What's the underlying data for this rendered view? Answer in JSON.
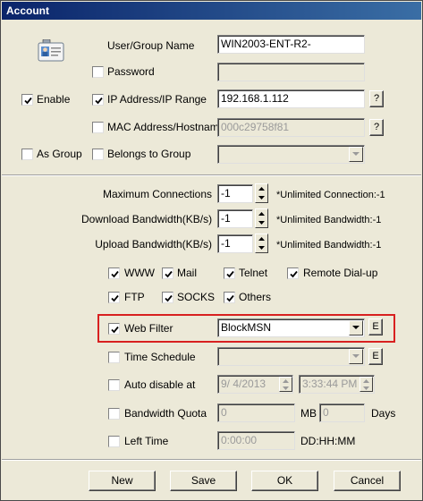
{
  "window": {
    "title": "Account"
  },
  "account": {
    "user_group_name_label": "User/Group Name",
    "user_group_name_value": "WIN2003-ENT-R2-",
    "password_label": "Password",
    "password_checked": false,
    "password_value": "",
    "enable_label": "Enable",
    "enable_checked": true,
    "ip_label": "IP Address/IP Range",
    "ip_checked": true,
    "ip_value": "192.168.1.112",
    "ip_help": "?",
    "mac_label": "MAC Address/Hostname",
    "mac_checked": false,
    "mac_value": "000c29758f81",
    "mac_help": "?",
    "as_group_label": "As Group",
    "as_group_checked": false,
    "belongs_label": "Belongs to Group",
    "belongs_checked": false,
    "belongs_value": ""
  },
  "limits": {
    "max_conn_label": "Maximum Connections",
    "max_conn_value": "-1",
    "max_conn_note": "*Unlimited Connection:-1",
    "down_label": "Download Bandwidth(KB/s)",
    "down_value": "-1",
    "down_note": "*Unlimited Bandwidth:-1",
    "up_label": "Upload Bandwidth(KB/s)",
    "up_value": "-1",
    "up_note": "*Unlimited Bandwidth:-1"
  },
  "services": {
    "www": "WWW",
    "mail": "Mail",
    "telnet": "Telnet",
    "remote_dialup": "Remote Dial-up",
    "ftp": "FTP",
    "socks": "SOCKS",
    "others": "Others",
    "checked": {
      "www": true,
      "mail": true,
      "telnet": true,
      "remote_dialup": true,
      "ftp": true,
      "socks": true,
      "others": true
    }
  },
  "web_filter": {
    "label": "Web Filter",
    "checked": true,
    "value": "BlockMSN",
    "edit": "E"
  },
  "time_schedule": {
    "label": "Time Schedule",
    "checked": false,
    "value": "",
    "edit": "E"
  },
  "auto_disable": {
    "label": "Auto disable at",
    "checked": false,
    "date": "9/  4/2013",
    "time": "3:33:44 PM"
  },
  "bandwidth_quota": {
    "label": "Bandwidth Quota",
    "checked": false,
    "mb_value": "0",
    "mb_unit": "MB",
    "days_value": "0",
    "days_unit": "Days"
  },
  "left_time": {
    "label": "Left Time",
    "checked": false,
    "value": "0:00:00",
    "format": "DD:HH:MM"
  },
  "buttons": {
    "new": "New",
    "save": "Save",
    "ok": "OK",
    "cancel": "Cancel"
  },
  "colors": {
    "titlebar_start": "#0a246a",
    "titlebar_end": "#3a6ea5",
    "highlight": "#d82020",
    "background": "#ece9d8"
  }
}
